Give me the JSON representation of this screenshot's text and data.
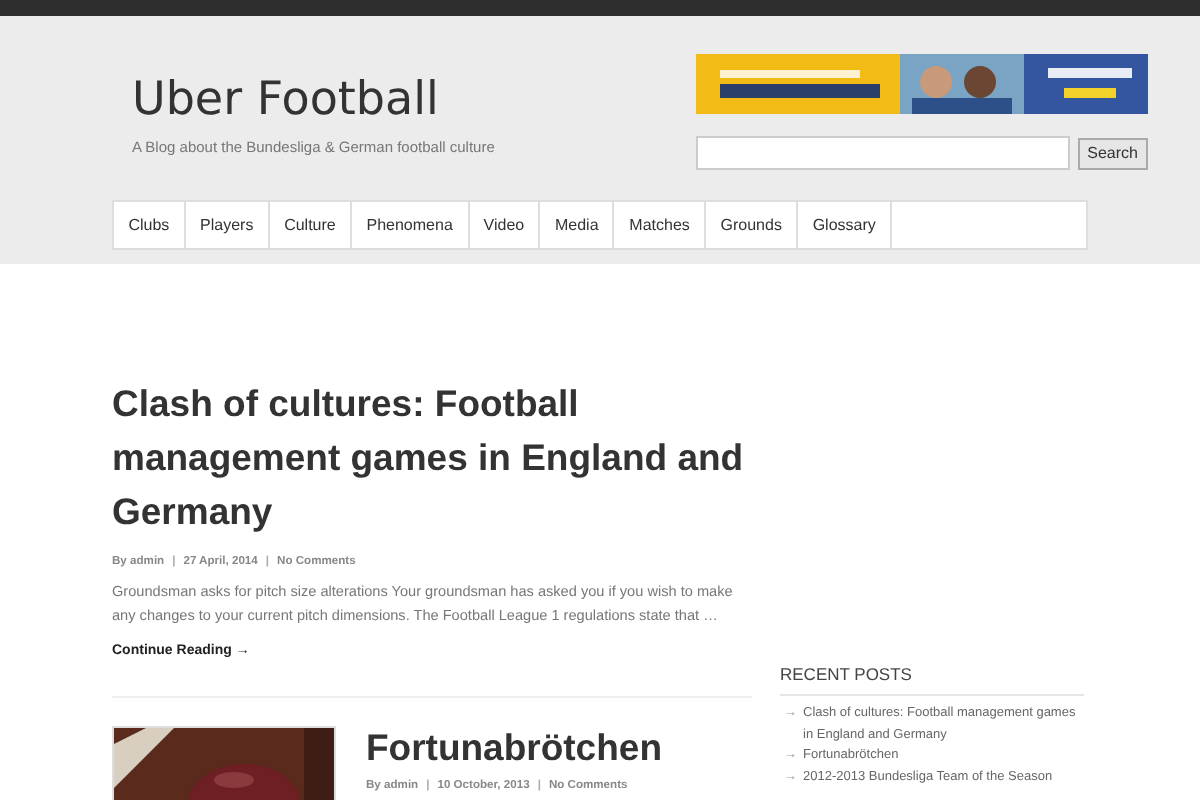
{
  "site": {
    "title": "Uber Football",
    "tagline": "A Blog about the Bundesliga & German football culture"
  },
  "search": {
    "button": "Search"
  },
  "nav": [
    {
      "label": "Clubs"
    },
    {
      "label": "Players"
    },
    {
      "label": "Culture"
    },
    {
      "label": "Phenomena"
    },
    {
      "label": "Video"
    },
    {
      "label": "Media"
    },
    {
      "label": "Matches"
    },
    {
      "label": "Grounds"
    },
    {
      "label": "Glossary"
    }
  ],
  "separator": "|",
  "posts": [
    {
      "title": "Clash of cultures: Football management games in England and Germany",
      "author": "By admin",
      "date": "27 April, 2014",
      "comments": "No Comments",
      "excerpt": "Groundsman asks for pitch size alterations Your groundsman has asked you if you wish to make any changes to your current pitch dimensions. The Football League 1 regulations state that …",
      "more": "Continue Reading →"
    },
    {
      "title": "Fortunabrötchen",
      "author": "By admin",
      "date": "10 October, 2013",
      "comments": "No Comments"
    }
  ],
  "sidebar": {
    "heading": "RECENT POSTS",
    "items": [
      {
        "arrow": "→",
        "label": "Clash of cultures: Football management games in England and Germany"
      },
      {
        "arrow": "→",
        "label": "Fortunabrötchen"
      },
      {
        "arrow": "→",
        "label": "2012-2013 Bundesliga Team of the Season"
      }
    ]
  }
}
